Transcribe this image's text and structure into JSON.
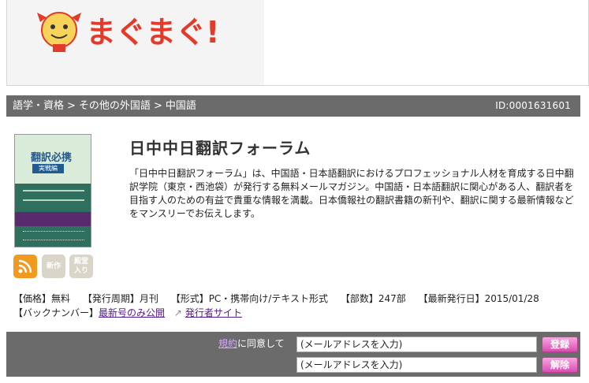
{
  "header": {
    "logo_text": "まぐまぐ!"
  },
  "breadcrumb": {
    "items": [
      "語学・資格",
      "その他の外国語",
      "中国語"
    ],
    "magazine_id": "ID:0001631601"
  },
  "magazine": {
    "title": "日中中日翻訳フォーラム",
    "description": "「日中中日翻訳フォーラム」は、中国語・日本語翻訳におけるプロフェッショナル人材を育成する日中翻訳学院（東京・西池袋）が発行する無料メールマガジン。中国語・日本語翻訳に関心がある人、翻訳者を目指す人のための有益で貴重な情報を満載。日本僑報社の翻訳書籍の新刊や、翻訳に関する最新情報などをマンスリーでお伝えします。"
  },
  "cover": {
    "title": "翻訳必携",
    "badge": "実戦編"
  },
  "badges": {
    "new": "新作",
    "hall_of_fame": "殿堂入り",
    "hall_line1": "殿堂",
    "hall_line2": "入り"
  },
  "meta": {
    "price": "【価格】無料",
    "cycle": "【発行周期】月刊",
    "format": "【形式】PC・携帯向け/テキスト形式",
    "subscribers": "【部数】247部",
    "latest": "【最新発行日】2015/01/28",
    "backnumber_label": "【バックナンバー】",
    "backnumber_link": "最新号のみ公開",
    "publisher_link": "発行者サイト"
  },
  "subscribe": {
    "terms_link": "規約",
    "agree_text": "に同意して",
    "email_placeholder": "(メールアドレスを入力)",
    "subscribe_button": "登録",
    "unsubscribe_button": "解除"
  }
}
